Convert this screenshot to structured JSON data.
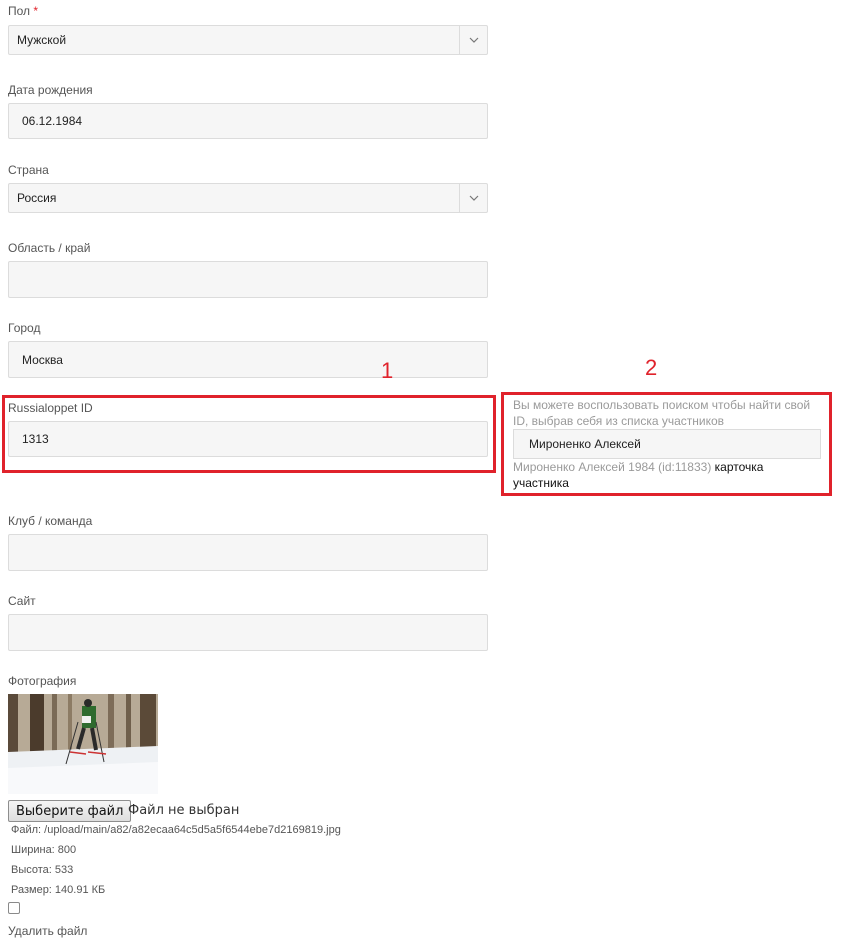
{
  "form": {
    "gender": {
      "label": "Пол",
      "required_mark": "*",
      "value": "Мужской"
    },
    "birthdate": {
      "label": "Дата рождения",
      "value": "06.12.1984"
    },
    "country": {
      "label": "Страна",
      "value": "Россия"
    },
    "region": {
      "label": "Область / край",
      "value": ""
    },
    "city": {
      "label": "Город",
      "value": "Москва"
    },
    "russialoppet_id": {
      "label": "Russialoppet ID",
      "value": "1313"
    },
    "club": {
      "label": "Клуб / команда",
      "value": ""
    },
    "site": {
      "label": "Сайт",
      "value": ""
    },
    "photo": {
      "label": "Фотография",
      "choose_button": "Выберите файл",
      "no_file_text": "Файл не выбран",
      "file_info": "Файл: /upload/main/a82/a82ecaa64c5d5a5f6544ebe7d2169819.jpg",
      "width_info": "Ширина: 800",
      "height_info": "Высота: 533",
      "size_info": "Размер: 140.91 КБ",
      "delete_label": "Удалить файл",
      "delete_checked": false
    }
  },
  "search_panel": {
    "hint": "Вы можете воспользовать поиском чтобы найти свой ID, выбрав себя из списка участников",
    "search_value": "Мироненко Алексей",
    "result_text": "Мироненко Алексей 1984 (id:11833)",
    "result_link": "карточка участника"
  },
  "annotations": {
    "box1_number": "1",
    "box2_number": "2",
    "color": "#e0222b"
  },
  "icons": {
    "select_arrow": "chevron-down-icon"
  }
}
